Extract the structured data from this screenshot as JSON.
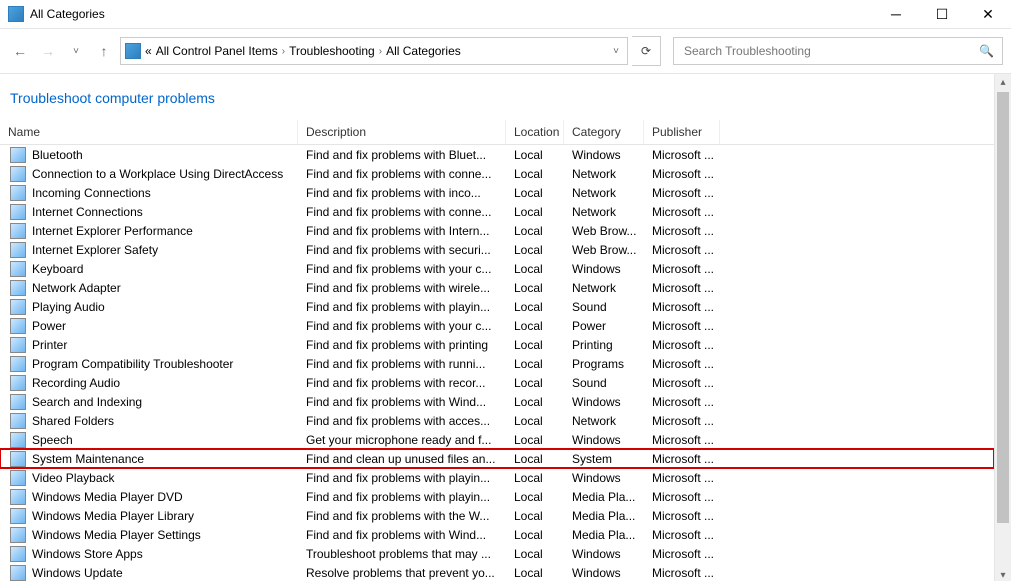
{
  "window": {
    "title": "All Categories"
  },
  "breadcrumb": {
    "root": "«",
    "items": [
      "All Control Panel Items",
      "Troubleshooting",
      "All Categories"
    ]
  },
  "search": {
    "placeholder": "Search Troubleshooting"
  },
  "heading": "Troubleshoot computer problems",
  "columns": {
    "name": "Name",
    "description": "Description",
    "location": "Location",
    "category": "Category",
    "publisher": "Publisher"
  },
  "rows": [
    {
      "name": "Bluetooth",
      "desc": "Find and fix problems with Bluet...",
      "loc": "Local",
      "cat": "Windows",
      "pub": "Microsoft ..."
    },
    {
      "name": "Connection to a Workplace Using DirectAccess",
      "desc": "Find and fix problems with conne...",
      "loc": "Local",
      "cat": "Network",
      "pub": "Microsoft ..."
    },
    {
      "name": "Incoming Connections",
      "desc": "Find and fix problems with inco...",
      "loc": "Local",
      "cat": "Network",
      "pub": "Microsoft ..."
    },
    {
      "name": "Internet Connections",
      "desc": "Find and fix problems with conne...",
      "loc": "Local",
      "cat": "Network",
      "pub": "Microsoft ..."
    },
    {
      "name": "Internet Explorer Performance",
      "desc": "Find and fix problems with Intern...",
      "loc": "Local",
      "cat": "Web Brow...",
      "pub": "Microsoft ..."
    },
    {
      "name": "Internet Explorer Safety",
      "desc": "Find and fix problems with securi...",
      "loc": "Local",
      "cat": "Web Brow...",
      "pub": "Microsoft ..."
    },
    {
      "name": "Keyboard",
      "desc": "Find and fix problems with your c...",
      "loc": "Local",
      "cat": "Windows",
      "pub": "Microsoft ..."
    },
    {
      "name": "Network Adapter",
      "desc": "Find and fix problems with wirele...",
      "loc": "Local",
      "cat": "Network",
      "pub": "Microsoft ..."
    },
    {
      "name": "Playing Audio",
      "desc": "Find and fix problems with playin...",
      "loc": "Local",
      "cat": "Sound",
      "pub": "Microsoft ..."
    },
    {
      "name": "Power",
      "desc": "Find and fix problems with your c...",
      "loc": "Local",
      "cat": "Power",
      "pub": "Microsoft ..."
    },
    {
      "name": "Printer",
      "desc": "Find and fix problems with printing",
      "loc": "Local",
      "cat": "Printing",
      "pub": "Microsoft ..."
    },
    {
      "name": "Program Compatibility Troubleshooter",
      "desc": "Find and fix problems with runni...",
      "loc": "Local",
      "cat": "Programs",
      "pub": "Microsoft ..."
    },
    {
      "name": "Recording Audio",
      "desc": "Find and fix problems with recor...",
      "loc": "Local",
      "cat": "Sound",
      "pub": "Microsoft ..."
    },
    {
      "name": "Search and Indexing",
      "desc": "Find and fix problems with Wind...",
      "loc": "Local",
      "cat": "Windows",
      "pub": "Microsoft ..."
    },
    {
      "name": "Shared Folders",
      "desc": "Find and fix problems with acces...",
      "loc": "Local",
      "cat": "Network",
      "pub": "Microsoft ..."
    },
    {
      "name": "Speech",
      "desc": "Get your microphone ready and f...",
      "loc": "Local",
      "cat": "Windows",
      "pub": "Microsoft ..."
    },
    {
      "name": "System Maintenance",
      "desc": "Find and clean up unused files an...",
      "loc": "Local",
      "cat": "System",
      "pub": "Microsoft ...",
      "highlight": true
    },
    {
      "name": "Video Playback",
      "desc": "Find and fix problems with playin...",
      "loc": "Local",
      "cat": "Windows",
      "pub": "Microsoft ..."
    },
    {
      "name": "Windows Media Player DVD",
      "desc": "Find and fix problems with playin...",
      "loc": "Local",
      "cat": "Media Pla...",
      "pub": "Microsoft ..."
    },
    {
      "name": "Windows Media Player Library",
      "desc": "Find and fix problems with the W...",
      "loc": "Local",
      "cat": "Media Pla...",
      "pub": "Microsoft ..."
    },
    {
      "name": "Windows Media Player Settings",
      "desc": "Find and fix problems with Wind...",
      "loc": "Local",
      "cat": "Media Pla...",
      "pub": "Microsoft ..."
    },
    {
      "name": "Windows Store Apps",
      "desc": "Troubleshoot problems that may ...",
      "loc": "Local",
      "cat": "Windows",
      "pub": "Microsoft ..."
    },
    {
      "name": "Windows Update",
      "desc": "Resolve problems that prevent yo...",
      "loc": "Local",
      "cat": "Windows",
      "pub": "Microsoft ..."
    }
  ]
}
